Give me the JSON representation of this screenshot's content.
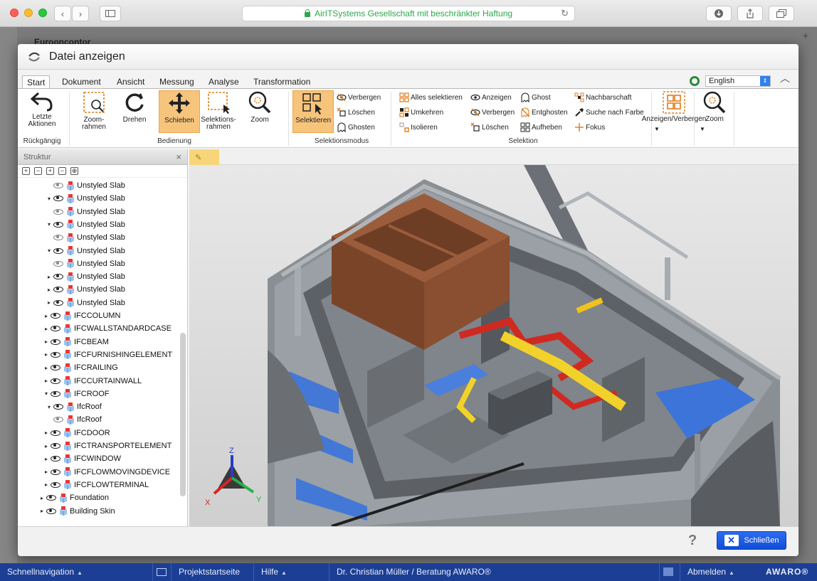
{
  "browser": {
    "url_text": "AirITSystems Gesellschaft mit beschränkter Haftung"
  },
  "background": {
    "title_fragment": "Eurooncontor"
  },
  "dialog": {
    "title": "Datei anzeigen",
    "tabs": [
      "Start",
      "Dokument",
      "Ansicht",
      "Messung",
      "Analyse",
      "Transformation"
    ],
    "active_tab": "Start",
    "language": "English",
    "ribbon": {
      "undo_label": "Letzte Aktionen",
      "undo_group": "Rückgängig",
      "bedienung_group": "Bedienung",
      "zoomrahmen_label": "Zoom-rahmen",
      "drehen_label": "Drehen",
      "schieben_label": "Schieben",
      "selektionsrahmen_label": "Selektions-rahmen",
      "zoom_label": "Zoom",
      "selektionsmodus_group": "Selektionsmodus",
      "selektieren_label": "Selektieren",
      "verbergen_label": "Verbergen",
      "loeschen_label": "Löschen",
      "ghosten_label": "Ghosten",
      "selektion_group": "Selektion",
      "alles_selektieren": "Alles selektieren",
      "umkehren": "Umkehren",
      "isolieren": "Isolieren",
      "anzeigen": "Anzeigen",
      "verbergen2": "Verbergen",
      "loeschen2": "Löschen",
      "ghost": "Ghost",
      "entghosten": "Entghosten",
      "aufheben": "Aufheben",
      "nachbarschaft": "Nachbarschaft",
      "suche_farbe": "Suche nach Farbe",
      "fokus": "Fokus",
      "anzeigen_verbergen": "Anzeigen/Verbergen",
      "zoom2": "Zoom"
    },
    "structure": {
      "title": "Struktur",
      "close": "×",
      "items": [
        {
          "label": "Unstyled Slab",
          "level": 2,
          "expand": "",
          "ghost": true
        },
        {
          "label": "Unstyled Slab",
          "level": 2,
          "expand": "▾",
          "ghost": false
        },
        {
          "label": "Unstyled Slab",
          "level": 2,
          "expand": "",
          "ghost": true
        },
        {
          "label": "Unstyled Slab",
          "level": 2,
          "expand": "▾",
          "ghost": false
        },
        {
          "label": "Unstyled Slab",
          "level": 2,
          "expand": "",
          "ghost": true
        },
        {
          "label": "Unstyled Slab",
          "level": 2,
          "expand": "▾",
          "ghost": false
        },
        {
          "label": "Unstyled Slab",
          "level": 2,
          "expand": "",
          "ghost": true
        },
        {
          "label": "Unstyled Slab",
          "level": 2,
          "expand": "▸",
          "ghost": false
        },
        {
          "label": "Unstyled Slab",
          "level": 2,
          "expand": "▸",
          "ghost": false
        },
        {
          "label": "Unstyled Slab",
          "level": 2,
          "expand": "▸",
          "ghost": false
        },
        {
          "label": "IFCCOLUMN",
          "level": 1,
          "expand": "▸",
          "ghost": false
        },
        {
          "label": "IFCWALLSTANDARDCASE",
          "level": 1,
          "expand": "▸",
          "ghost": false
        },
        {
          "label": "IFCBEAM",
          "level": 1,
          "expand": "▸",
          "ghost": false
        },
        {
          "label": "IFCFURNISHINGELEMENT",
          "level": 1,
          "expand": "▸",
          "ghost": false
        },
        {
          "label": "IFCRAILING",
          "level": 1,
          "expand": "▸",
          "ghost": false
        },
        {
          "label": "IFCCURTAINWALL",
          "level": 1,
          "expand": "▸",
          "ghost": false
        },
        {
          "label": "IFCROOF",
          "level": 1,
          "expand": "▾",
          "ghost": false
        },
        {
          "label": "IfcRoof",
          "level": 2,
          "expand": "▾",
          "ghost": false
        },
        {
          "label": "IfcRoof",
          "level": 2,
          "expand": "",
          "ghost": true
        },
        {
          "label": "IFCDOOR",
          "level": 1,
          "expand": "▸",
          "ghost": false
        },
        {
          "label": "IFCTRANSPORTELEMENT",
          "level": 1,
          "expand": "▸",
          "ghost": false
        },
        {
          "label": "IFCWINDOW",
          "level": 1,
          "expand": "▸",
          "ghost": false
        },
        {
          "label": "IFCFLOWMOVINGDEVICE",
          "level": 1,
          "expand": "▸",
          "ghost": false
        },
        {
          "label": "IFCFLOWTERMINAL",
          "level": 1,
          "expand": "▸",
          "ghost": false
        },
        {
          "label": "Foundation",
          "level": 0,
          "expand": "▸",
          "ghost": false
        },
        {
          "label": "Building Skin",
          "level": 0,
          "expand": "▸",
          "ghost": false
        }
      ]
    },
    "axes": {
      "x": "X",
      "y": "Y",
      "z": "Z"
    },
    "footer": {
      "help": "?",
      "close_label": "Schließen"
    }
  },
  "statusbar": {
    "schnellnavigation": "Schnellnavigation",
    "projektstartseite": "Projektstartseite",
    "hilfe": "Hilfe",
    "user": "Dr. Christian Müller / Beratung AWARO®",
    "abmelden": "Abmelden",
    "brand": "AWARO®"
  },
  "colors": {
    "accent": "#2d6cf2",
    "selected": "#f7c47c",
    "statusbar": "#1c3f95",
    "url_green": "#2aa84a"
  }
}
